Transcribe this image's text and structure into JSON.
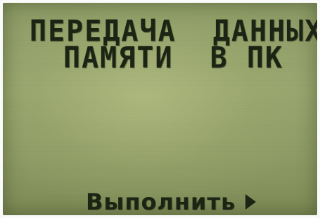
{
  "display": {
    "title_line_1": "ПЕРЕДАЧА  ДАННЫХ",
    "title_line_2": "ПАМЯТИ  В ПК"
  },
  "softkey": {
    "label": "Выполнить",
    "icon": "arrow-right-icon"
  },
  "colors": {
    "lcd_background": "#9aa66f",
    "lcd_text": "#1c2414"
  }
}
